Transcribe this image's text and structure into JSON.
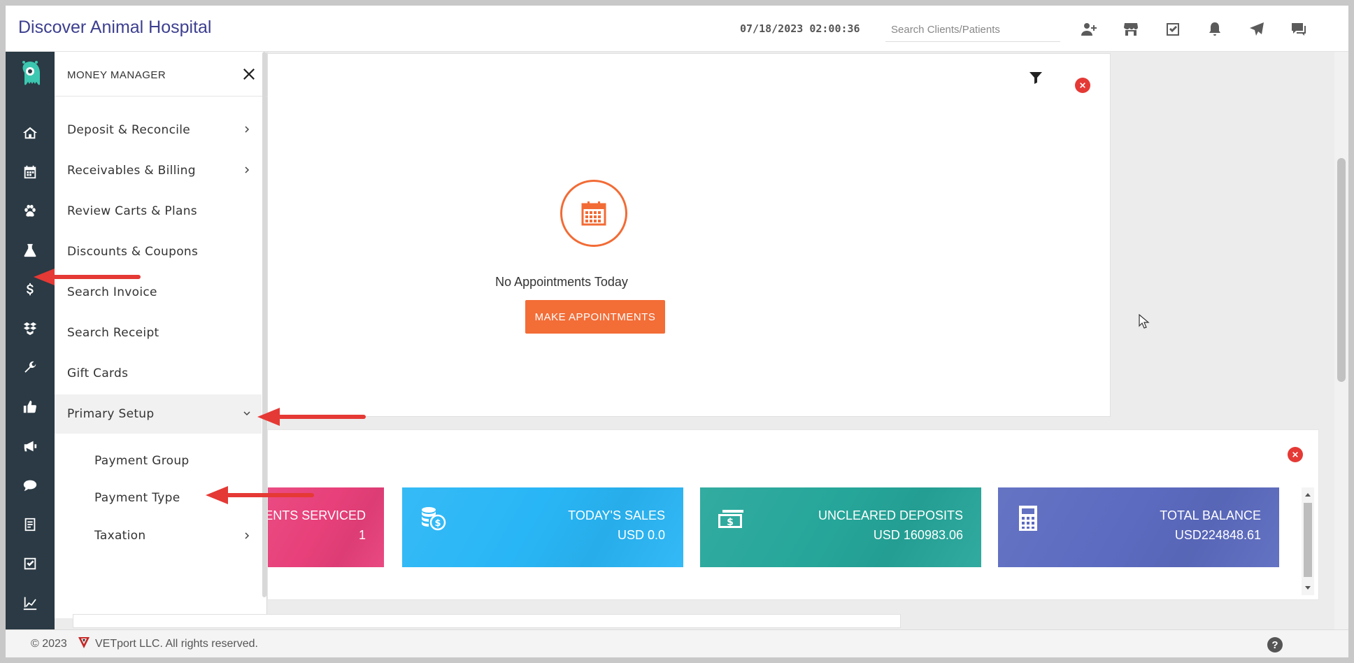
{
  "header": {
    "brand": "Discover Animal Hospital",
    "datetime": "07/18/2023 02:00:36",
    "search_placeholder": "Search Clients/Patients",
    "icons": [
      "add-user-icon",
      "store-icon",
      "task-check-icon",
      "bell-icon",
      "send-icon",
      "chat-icon"
    ]
  },
  "rail": {
    "icons": [
      "home-icon",
      "calendar-icon",
      "paw-icon",
      "lab-flask-icon",
      "dollar-icon",
      "boxes-icon",
      "wrench-icon",
      "thumbs-up-icon",
      "megaphone-icon",
      "chat-bubbles-icon",
      "document-icon",
      "checkbox-icon",
      "chart-icon"
    ]
  },
  "flyout": {
    "title": "MONEY MANAGER",
    "items": [
      {
        "label": "Deposit & Reconcile",
        "has_arrow": true
      },
      {
        "label": "Receivables & Billing",
        "has_arrow": true
      },
      {
        "label": "Review Carts & Plans",
        "has_arrow": false
      },
      {
        "label": "Discounts & Coupons",
        "has_arrow": false
      },
      {
        "label": "Search Invoice",
        "has_arrow": false
      },
      {
        "label": "Search Receipt",
        "has_arrow": false
      },
      {
        "label": "Gift Cards",
        "has_arrow": false
      },
      {
        "label": "Primary Setup",
        "expanded": true
      }
    ],
    "sub_items": [
      {
        "label": "Payment Group",
        "has_arrow": false
      },
      {
        "label": "Payment Type",
        "has_arrow": false
      },
      {
        "label": "Taxation",
        "has_arrow": true
      }
    ]
  },
  "appointments": {
    "empty_text": "No Appointments Today",
    "button_label": "MAKE APPOINTMENTS",
    "accent": "#f36d37"
  },
  "stats": {
    "tiles": [
      {
        "label": "TIENTS SERVICED",
        "value": "1",
        "color": "#e8407a",
        "icon": ""
      },
      {
        "label": "TODAY'S SALES",
        "value": "USD 0.0",
        "color": "#29b6f6",
        "icon": "coins-dollar-icon"
      },
      {
        "label": "UNCLEARED DEPOSITS",
        "value": "USD 160983.06",
        "color": "#26a69a",
        "icon": "cash-icon"
      },
      {
        "label": "TOTAL BALANCE",
        "value": "USD224848.61",
        "color": "#5c6bc0",
        "icon": "calculator-icon"
      }
    ]
  },
  "footer": {
    "copyright": "© 2023",
    "company": "VETport LLC. All rights reserved.",
    "help": "?"
  },
  "colors": {
    "rail_bg": "#2b3a44",
    "brand": "#3d3f8f",
    "close_red": "#e53935",
    "annotation_arrow": "#e53935"
  }
}
